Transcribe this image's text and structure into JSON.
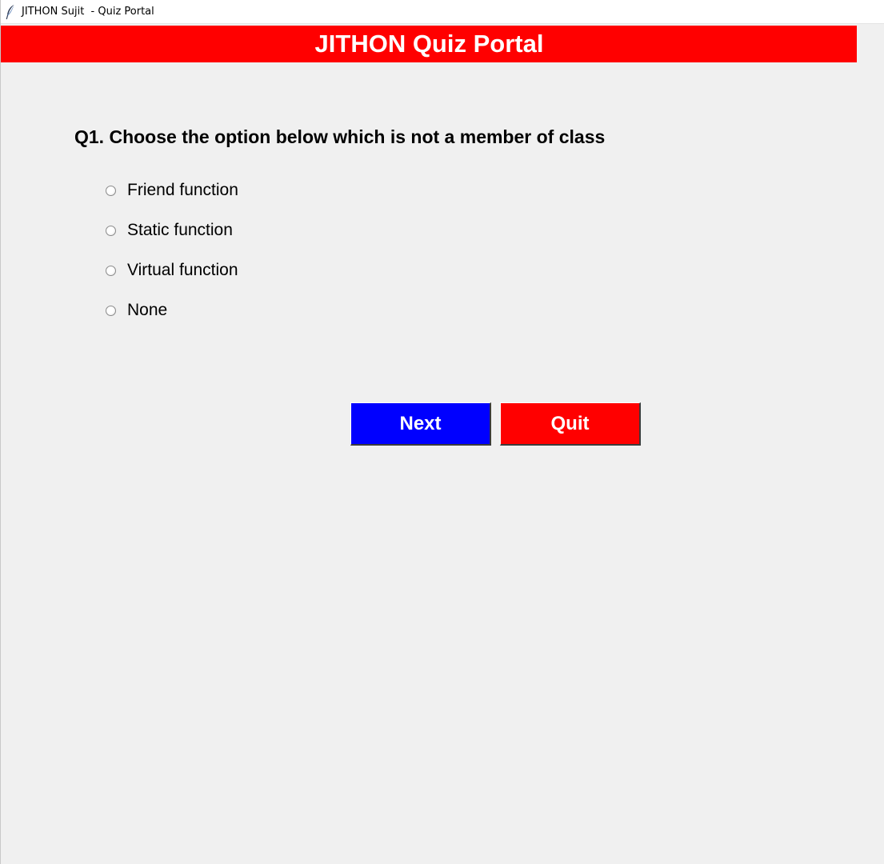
{
  "window": {
    "title": "JITHON Sujit  - Quiz Portal",
    "icon": "feather-icon"
  },
  "header": {
    "title": "JITHON Quiz Portal",
    "background": "#ff0000",
    "text_color": "#ffffff"
  },
  "question": {
    "text": "Q1. Choose the option below which is not a member of class",
    "options": [
      {
        "label": "Friend function",
        "selected": false
      },
      {
        "label": "Static function",
        "selected": false
      },
      {
        "label": "Virtual function",
        "selected": false
      },
      {
        "label": "None",
        "selected": false
      }
    ]
  },
  "buttons": {
    "next_label": "Next",
    "next_color": "#0000ff",
    "quit_label": "Quit",
    "quit_color": "#ff0000"
  }
}
